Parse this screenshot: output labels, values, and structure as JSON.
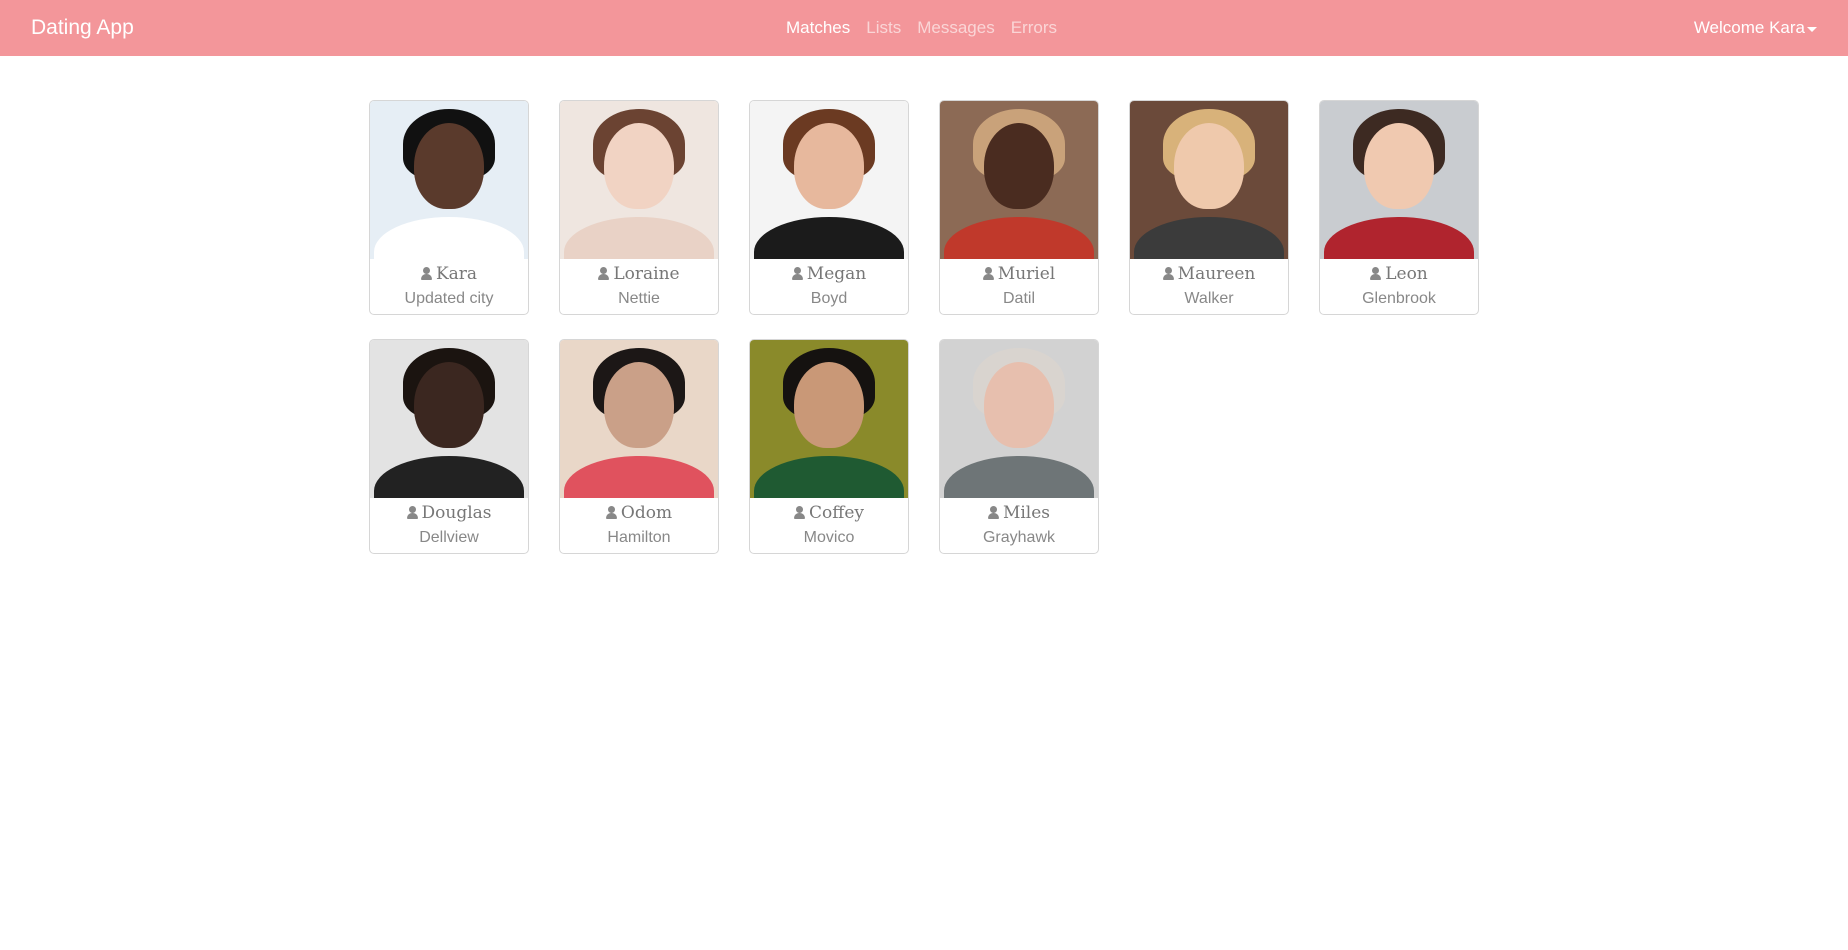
{
  "navbar": {
    "brand": "Dating App",
    "links": [
      {
        "label": "Matches",
        "active": true
      },
      {
        "label": "Lists",
        "active": false
      },
      {
        "label": "Messages",
        "active": false
      },
      {
        "label": "Errors",
        "active": false
      }
    ],
    "user_menu": "Welcome Kara"
  },
  "icons": {
    "user": "user-icon",
    "dropdown": "caret-down-icon"
  },
  "colors": {
    "navbar": "#f3969a",
    "text_muted": "#888888"
  },
  "members": [
    {
      "name": "Kara",
      "city": "Updated city",
      "photo": {
        "bg": "#e6eef5",
        "skin": "#5a3a2c",
        "hair": "#111111",
        "clothes": "#ffffff"
      }
    },
    {
      "name": "Loraine",
      "city": "Nettie",
      "photo": {
        "bg": "#efe6e0",
        "skin": "#f1d3c3",
        "hair": "#6b4332",
        "clothes": "#e9d2c6"
      }
    },
    {
      "name": "Megan",
      "city": "Boyd",
      "photo": {
        "bg": "#f4f4f4",
        "skin": "#e7b89d",
        "hair": "#6b3a22",
        "clothes": "#1b1b1b"
      }
    },
    {
      "name": "Muriel",
      "city": "Datil",
      "photo": {
        "bg": "#8c6a55",
        "skin": "#4a2c20",
        "hair": "#c9a27a",
        "clothes": "#c0392b"
      }
    },
    {
      "name": "Maureen",
      "city": "Walker",
      "photo": {
        "bg": "#6b4a3a",
        "skin": "#efc9ac",
        "hair": "#d8b27a",
        "clothes": "#3b3b3b"
      }
    },
    {
      "name": "Leon",
      "city": "Glenbrook",
      "photo": {
        "bg": "#c9ccd0",
        "skin": "#f0c9b0",
        "hair": "#3d2a22",
        "clothes": "#b0242e"
      }
    },
    {
      "name": "Douglas",
      "city": "Dellview",
      "photo": {
        "bg": "#e3e3e3",
        "skin": "#3b2720",
        "hair": "#1b1410",
        "clothes": "#222222"
      }
    },
    {
      "name": "Odom",
      "city": "Hamilton",
      "photo": {
        "bg": "#e9d7c8",
        "skin": "#caa088",
        "hair": "#1c1716",
        "clothes": "#e0525e"
      }
    },
    {
      "name": "Coffey",
      "city": "Movico",
      "photo": {
        "bg": "#8a8a2a",
        "skin": "#c99877",
        "hair": "#151210",
        "clothes": "#1f5a32"
      }
    },
    {
      "name": "Miles",
      "city": "Grayhawk",
      "photo": {
        "bg": "#d2d2d2",
        "skin": "#e7bfae",
        "hair": "#d9d4cf",
        "clothes": "#6e7577"
      }
    }
  ]
}
